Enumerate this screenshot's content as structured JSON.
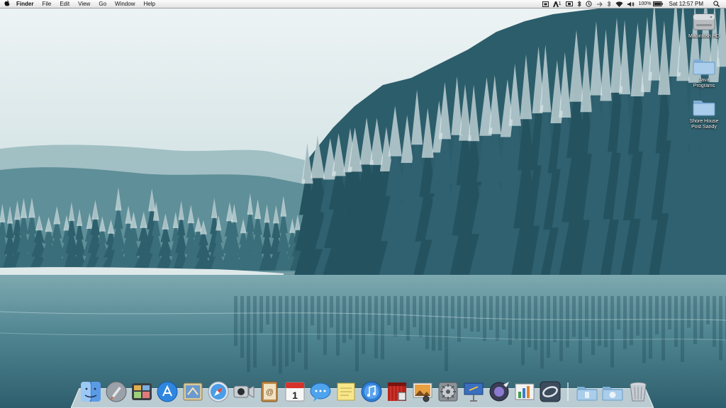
{
  "menubar": {
    "apple_icon": "apple-icon",
    "app_name": "Finder",
    "menus": [
      "File",
      "Edit",
      "View",
      "Go",
      "Window",
      "Help"
    ],
    "status_text": {
      "adobe_count": "1",
      "battery": "100%",
      "clock": "Sat 12:57 PM"
    },
    "status_icons": [
      "adobe-icon",
      "display-icon",
      "bluetooth-icon",
      "time-machine-icon",
      "wifi-icon",
      "volume-icon",
      "battery-icon",
      "spotlight-icon"
    ]
  },
  "desktop_icons": [
    {
      "name": "macintosh-hd",
      "label": "Macintosh HD",
      "icon": "hard-drive-icon"
    },
    {
      "name": "java-programs",
      "label": "Java\nPrograms",
      "icon": "folder-icon"
    },
    {
      "name": "shore-house",
      "label": "Shore House\nPost Sandy",
      "icon": "folder-icon"
    }
  ],
  "dock": {
    "apps": [
      {
        "name": "finder",
        "icon": "finder-icon"
      },
      {
        "name": "launchpad",
        "icon": "launchpad-icon"
      },
      {
        "name": "mission-control",
        "icon": "mission-control-icon"
      },
      {
        "name": "app-store",
        "icon": "app-store-icon"
      },
      {
        "name": "mail",
        "icon": "mail-icon"
      },
      {
        "name": "safari",
        "icon": "safari-icon"
      },
      {
        "name": "facetime",
        "icon": "facetime-icon"
      },
      {
        "name": "contacts",
        "icon": "contacts-icon"
      },
      {
        "name": "calendar",
        "icon": "calendar-icon",
        "text": "1"
      },
      {
        "name": "messages",
        "icon": "messages-icon"
      },
      {
        "name": "stickies",
        "icon": "stickies-icon"
      },
      {
        "name": "itunes",
        "icon": "itunes-icon"
      },
      {
        "name": "photo-booth",
        "icon": "photo-booth-icon"
      },
      {
        "name": "iphoto",
        "icon": "iphoto-icon"
      },
      {
        "name": "system-preferences",
        "icon": "gear-icon"
      },
      {
        "name": "keynote",
        "icon": "keynote-icon"
      },
      {
        "name": "aperture",
        "icon": "aperture-icon"
      },
      {
        "name": "numbers",
        "icon": "numbers-icon"
      },
      {
        "name": "time-machine-app",
        "icon": "orbit-icon"
      }
    ],
    "right": [
      {
        "name": "documents-stack",
        "icon": "folder-icon"
      },
      {
        "name": "downloads-stack",
        "icon": "download-folder-icon"
      },
      {
        "name": "trash",
        "icon": "trash-icon"
      }
    ]
  }
}
